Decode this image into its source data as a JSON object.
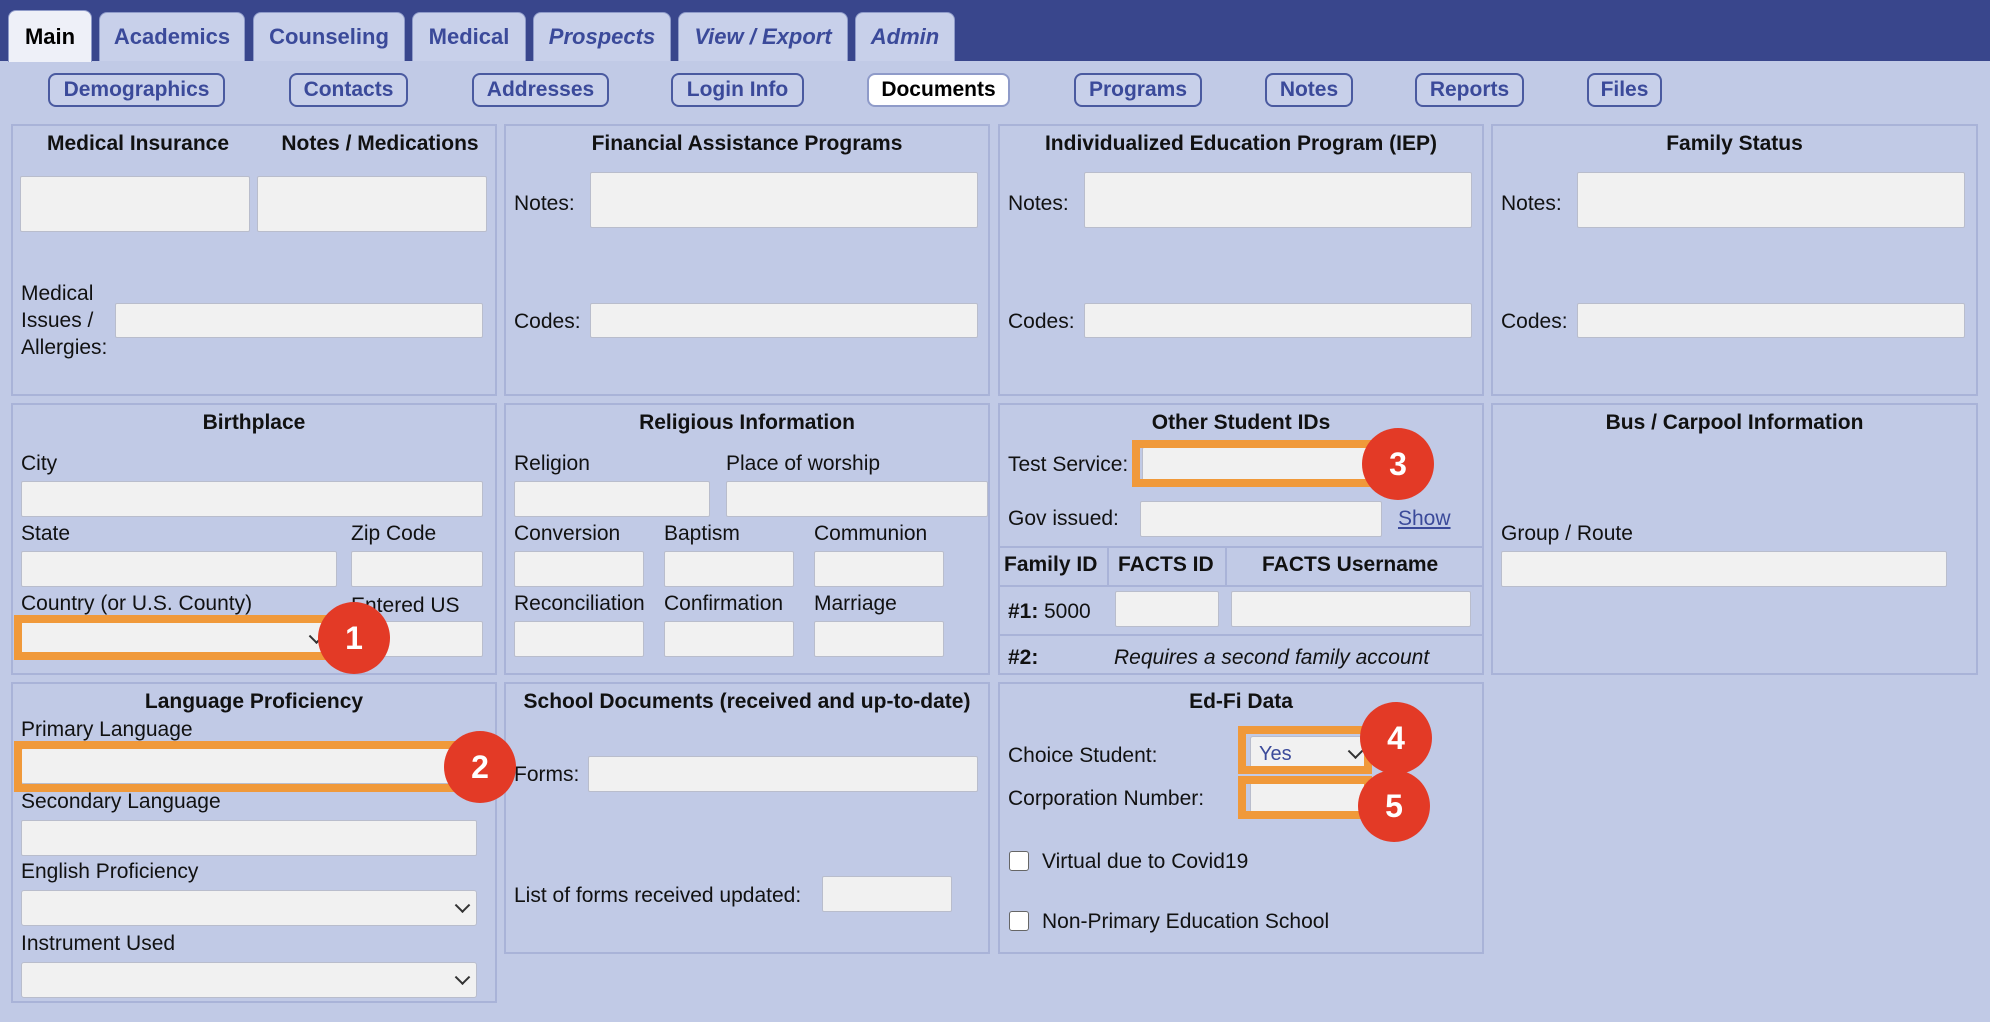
{
  "tabs": [
    "Main",
    "Academics",
    "Counseling",
    "Medical",
    "Prospects",
    "View / Export",
    "Admin"
  ],
  "subtabs": [
    "Demographics",
    "Contacts",
    "Addresses",
    "Login Info",
    "Documents",
    "Programs",
    "Notes",
    "Reports",
    "Files"
  ],
  "medical": {
    "title_insurance": "Medical Insurance",
    "title_notes": "Notes / Medications",
    "issues_label_1": "Medical",
    "issues_label_2": "Issues /",
    "issues_label_3": "Allergies:"
  },
  "financial": {
    "title": "Financial Assistance Programs",
    "notes_label": "Notes:",
    "codes_label": "Codes:"
  },
  "iep": {
    "title": "Individualized Education Program (IEP)",
    "notes_label": "Notes:",
    "codes_label": "Codes:"
  },
  "family_status": {
    "title": "Family Status",
    "notes_label": "Notes:",
    "codes_label": "Codes:"
  },
  "birthplace": {
    "title": "Birthplace",
    "city_label": "City",
    "state_label": "State",
    "zip_label": "Zip Code",
    "country_label": "Country (or U.S. County)",
    "entered_label": "Entered US"
  },
  "religious": {
    "title": "Religious Information",
    "religion": "Religion",
    "worship": "Place of worship",
    "conversion": "Conversion",
    "baptism": "Baptism",
    "communion": "Communion",
    "reconciliation": "Reconciliation",
    "confirmation": "Confirmation",
    "marriage": "Marriage"
  },
  "other_ids": {
    "title": "Other Student IDs",
    "test_service": "Test Service:",
    "gov_issued": "Gov issued:",
    "show": "Show",
    "col_family": "Family ID",
    "col_facts": "FACTS ID",
    "col_username": "FACTS Username",
    "row1_label": "#1:",
    "row1_value": "5000",
    "row2_label": "#2:",
    "row2_note": "Requires a second family account"
  },
  "bus": {
    "title": "Bus / Carpool Information",
    "group_label": "Group / Route"
  },
  "language": {
    "title": "Language Proficiency",
    "primary": "Primary Language",
    "secondary": "Secondary Language",
    "english": "English Proficiency",
    "instrument": "Instrument Used"
  },
  "school_docs": {
    "title": "School Documents (received and up-to-date)",
    "forms": "Forms:",
    "updated": "List of forms received updated:"
  },
  "edfi": {
    "title": "Ed-Fi Data",
    "choice_label": "Choice Student:",
    "choice_value": "Yes",
    "corp_label": "Corporation Number:",
    "virtual_label": "Virtual due to Covid19",
    "nonprimary_label": "Non-Primary Education School"
  },
  "badges": [
    "1",
    "2",
    "3",
    "4",
    "5"
  ],
  "colors": {
    "header": "#39468c",
    "highlight": "#f0993a",
    "badge": "#e33a26",
    "background": "#c1cae6"
  }
}
